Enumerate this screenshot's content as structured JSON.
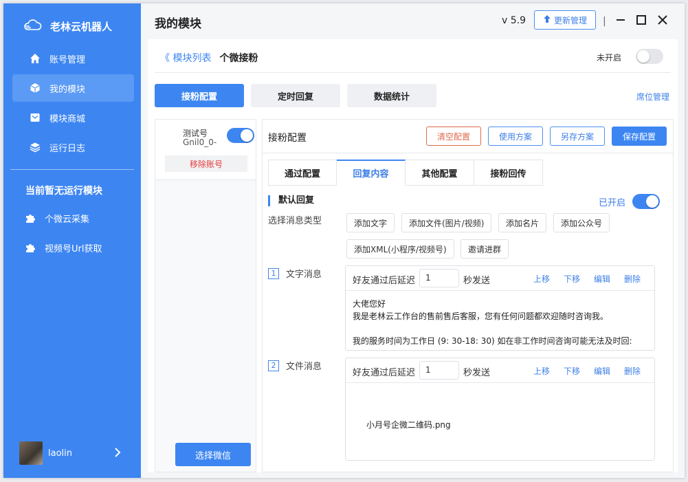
{
  "sidebar": {
    "brand": "老林云机器人",
    "nav": [
      {
        "label": "账号管理",
        "icon": "home-icon"
      },
      {
        "label": "我的模块",
        "icon": "cube-icon"
      },
      {
        "label": "模块商城",
        "icon": "mail-icon"
      },
      {
        "label": "运行日志",
        "icon": "layers-icon"
      }
    ],
    "section_title": "当前暂无运行模块",
    "plugins": [
      {
        "label": "个微云采集",
        "icon": "puzzle-icon"
      },
      {
        "label": "视频号Url获取",
        "icon": "puzzle-icon"
      }
    ],
    "user": {
      "name": "laolin"
    }
  },
  "header": {
    "title": "我的模块",
    "version": "v 5.9",
    "update_label": "更新管理",
    "separator": "|"
  },
  "main": {
    "breadcrumb": {
      "back": "《 模块列表",
      "current": "个微接粉"
    },
    "module_status": "未开启",
    "tabs": [
      "接粉配置",
      "定时回复",
      "数据统计"
    ],
    "seat_link": "席位管理",
    "account": {
      "name": "测试号",
      "id": "Gnil0_0-",
      "remove_label": "移除账号",
      "select_label": "选择微信"
    },
    "config": {
      "title": "接粉配置",
      "clear_label": "清空配置",
      "use_plan_label": "使用方案",
      "save_as_label": "另存方案",
      "save_label": "保存配置",
      "sub_tabs": [
        "通过配置",
        "回复内容",
        "其他配置",
        "接粉回传"
      ],
      "default_reply": "默认回复",
      "reply_status": "已开启",
      "msg_type_label": "选择消息类型",
      "msg_types": [
        "添加文字",
        "添加文件(图片/视频)",
        "添加名片",
        "添加公众号",
        "添加XML(小程序/视频号)",
        "邀请进群"
      ],
      "messages": [
        {
          "num": "1",
          "label": "文字消息",
          "delay_label": "好友通过后延迟",
          "delay": "1",
          "unit": "秒发送",
          "actions": [
            "上移",
            "下移",
            "编辑",
            "删除"
          ],
          "lines": [
            "大佬您好",
            "我是老林云工作台的售前售后客服，您有任何问题都欢迎随时咨询我。",
            "",
            "我的服务时间为工作日 (9: 30-18: 30) 如在非工作时间咨询可能无法及时回:"
          ]
        },
        {
          "num": "2",
          "label": "文件消息",
          "delay_label": "好友通过后延迟",
          "delay": "1",
          "unit": "秒发送",
          "actions": [
            "上移",
            "下移",
            "编辑",
            "删除"
          ],
          "file": "小月号企微二维码.png"
        }
      ]
    }
  },
  "colors": {
    "primary": "#3d86f2",
    "danger": "#e4393c",
    "sidebar": "#3d86f2"
  }
}
